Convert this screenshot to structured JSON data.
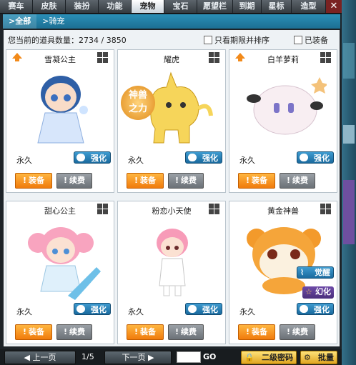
{
  "tabs": [
    {
      "label": "赛车"
    },
    {
      "label": "皮肤"
    },
    {
      "label": "装扮"
    },
    {
      "label": "功能"
    },
    {
      "label": "宠物"
    },
    {
      "label": "宝石"
    },
    {
      "label": "愿望栏"
    },
    {
      "label": "到期"
    },
    {
      "label": "星标"
    },
    {
      "label": "造型"
    }
  ],
  "subtabs": [
    {
      "label": "全部"
    },
    {
      "label": "骑宠"
    }
  ],
  "info": {
    "count_text": "您当前的道具数量：2734 / 3850",
    "option_expiry": "只看期限并排序",
    "option_equipped": "已装备"
  },
  "pets": [
    {
      "name": "雪凝公主",
      "duration": "永久",
      "enhance": "强化",
      "equip": "装备",
      "renew": "续费"
    },
    {
      "name": "耀虎",
      "duration": "永久",
      "enhance": "强化",
      "equip": "装备",
      "renew": "续费",
      "art_text_1": "神兽",
      "art_text_2": "之力"
    },
    {
      "name": "白羊萝莉",
      "duration": "永久",
      "enhance": "强化",
      "equip": "装备",
      "renew": "续费"
    },
    {
      "name": "甜心公主",
      "duration": "永久",
      "enhance": "强化",
      "equip": "装备",
      "renew": "续费"
    },
    {
      "name": "粉恋小天使",
      "duration": "永久",
      "enhance": "强化",
      "equip": "装备",
      "renew": "续费"
    },
    {
      "name": "黄金神兽",
      "duration": "永久",
      "enhance": "强化",
      "equip": "装备",
      "renew": "续费",
      "awaken": "觉醒",
      "transform": "幻化"
    }
  ],
  "footer": {
    "prev": "上一页",
    "page": "1/5",
    "next": "下一页",
    "go": "GO",
    "secondary_pwd": "二级密码",
    "batch": "批量"
  }
}
